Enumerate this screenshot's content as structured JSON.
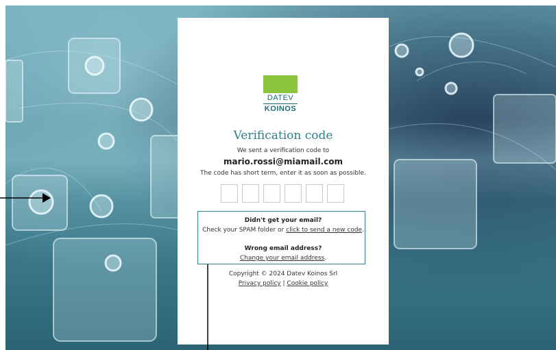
{
  "logo": {
    "brand_top": "DATEV",
    "brand_bottom": "KOINOS"
  },
  "title": "Verification code",
  "sent_text": "We sent a verification code to",
  "email": "mario.rossi@miamail.com",
  "expiry_text": "The code has short term, enter it as soon as possible.",
  "code_inputs": [
    "",
    "",
    "",
    "",
    "",
    ""
  ],
  "help": {
    "no_email_heading": "Didn't get your email?",
    "spam_text_prefix": "Check your SPAM folder or ",
    "resend_link": "click to send a new code",
    "spam_text_suffix": ".",
    "wrong_email_heading": "Wrong email address?",
    "change_email_link": "Change your email address",
    "change_email_suffix": "."
  },
  "footer": {
    "copyright": "Copyright © 2024 Datev Koinos Srl",
    "privacy_link": "Privacy policy",
    "separator": " | ",
    "cookie_link": "Cookie policy"
  },
  "colors": {
    "accent": "#2e7d8c",
    "logo_green": "#8bc53f",
    "annotation": "#000000"
  }
}
